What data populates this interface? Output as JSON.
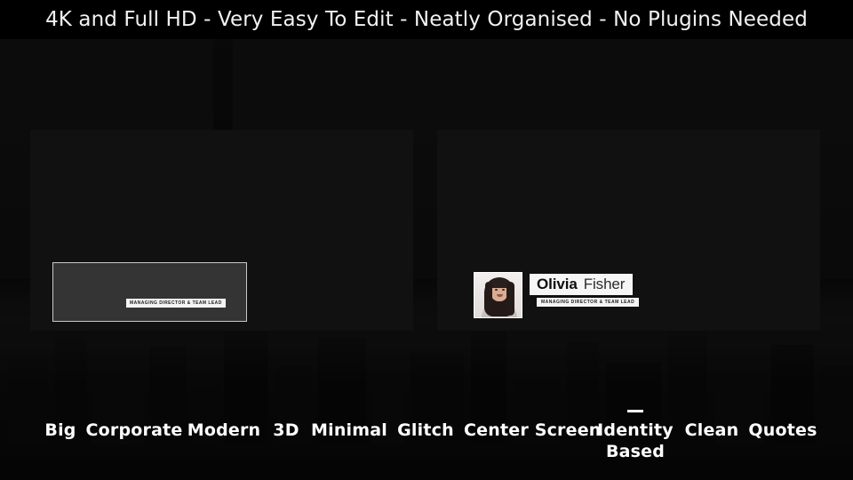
{
  "banner": {
    "text": "4K and Full HD - Very Easy To Edit - Neatly Organised - No Plugins Needed"
  },
  "preview_left": {
    "role_tag": "MANAGING DIRECTOR & TEAM LEAD"
  },
  "preview_right": {
    "first_name": "Olivia",
    "last_name": "Fisher",
    "role_tag": "MANAGING DIRECTOR & TEAM LEAD",
    "photo_alt": "portrait-photo"
  },
  "nav": {
    "items": [
      {
        "label": "Big",
        "active": false
      },
      {
        "label": "Corporate",
        "active": false
      },
      {
        "label": "Modern",
        "active": false
      },
      {
        "label": "3D",
        "active": false
      },
      {
        "label": "Minimal",
        "active": false
      },
      {
        "label": "Glitch",
        "active": false
      },
      {
        "label": "Center Screen",
        "active": true
      },
      {
        "label": "Identity Based",
        "active": false
      },
      {
        "label": "Clean",
        "active": false
      },
      {
        "label": "Quotes",
        "active": false
      }
    ]
  },
  "colors": {
    "banner_bg": "#000000",
    "text_primary": "#ffffff",
    "panel_bg": "#111111",
    "placeholder_gray": "#343434",
    "tag_bg": "#f4f4f4",
    "tag_text": "#1a1a1a"
  }
}
